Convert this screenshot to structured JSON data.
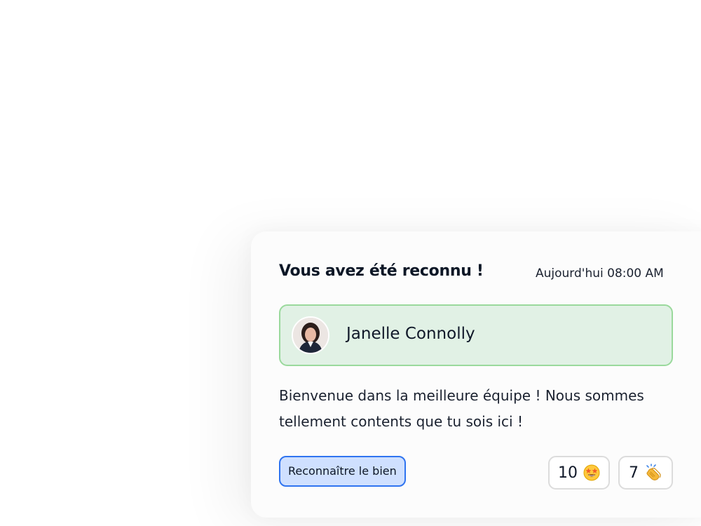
{
  "notification": {
    "title": "Vous avez été reconnu !",
    "timestamp": "Aujourd'hui 08:00 AM",
    "sender": {
      "name": "Janelle Connolly",
      "avatar_icon": "person-photo"
    },
    "message": "Bienvenue dans la meilleure équipe ! Nous sommes tellement contents que tu sois ici !",
    "recognize_button_label": "Reconnaître le bien",
    "reactions": [
      {
        "count": "10",
        "icon": "star-struck-emoji-icon"
      },
      {
        "count": "7",
        "icon": "clapping-hands-emoji-icon"
      }
    ]
  },
  "colors": {
    "sender_bg": "#e1f1e5",
    "sender_border": "#9ad99c",
    "button_bg": "#cfe0ff",
    "button_border": "#2f74f0"
  }
}
